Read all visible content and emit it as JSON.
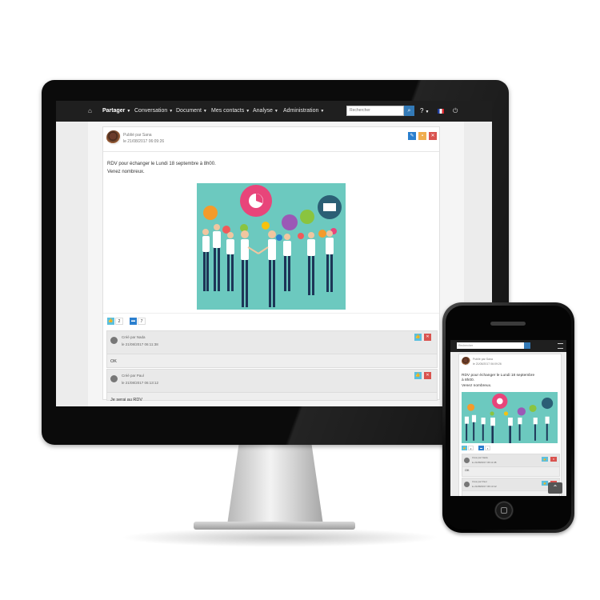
{
  "navbar": {
    "items": [
      {
        "label": "Partager"
      },
      {
        "label": "Conversation"
      },
      {
        "label": "Document"
      },
      {
        "label": "Mes contacts"
      },
      {
        "label": "Analyse"
      },
      {
        "label": "Administration"
      }
    ],
    "search_placeholder": "Rechercher",
    "help_symbol": "?",
    "icons": [
      "home-icon",
      "search-icon",
      "help-icon",
      "french-flag-icon",
      "power-icon"
    ]
  },
  "post": {
    "author": "Publié par Sana",
    "date": "le 21/08/2017 06:09:26",
    "text_line1": "RDV pour échanger le Lundi 18 septembre à 8h00.",
    "text_line2": "Venez nombreux.",
    "likes": "2",
    "comments_count": "7"
  },
  "comments": [
    {
      "author": "Créé par Nada",
      "date": "le 21/08/2017 06:11:38",
      "text": "OK"
    },
    {
      "author": "Créé par Paul",
      "date": "le 21/08/2017 06:13:12",
      "text": "Je serai au RDV"
    }
  ],
  "mobile": {
    "search_placeholder": "Rechercher",
    "post_text_line1": "RDV pour échanger le Lundi 18 septembre",
    "post_text_line2": "à 8h00.",
    "post_text_line3": "Venez nombreux.",
    "author": "Publié par Sana",
    "date": "le 21/08/2017 06:09:26",
    "likes": "2",
    "comments_count": "7",
    "comments": [
      {
        "author": "Créé par Nada",
        "date": "le 21/08/2017 06:11:38",
        "text": "OK"
      },
      {
        "author": "Créé par Paul",
        "date": "le 21/08/2017 06:13:12"
      }
    ]
  },
  "colors": {
    "accent": "#337ab7",
    "edit": "#2b7fce",
    "lock": "#f0ad4e",
    "delete": "#d9534f",
    "like": "#5bc0de",
    "illustration_bg": "#6cc9bf"
  }
}
